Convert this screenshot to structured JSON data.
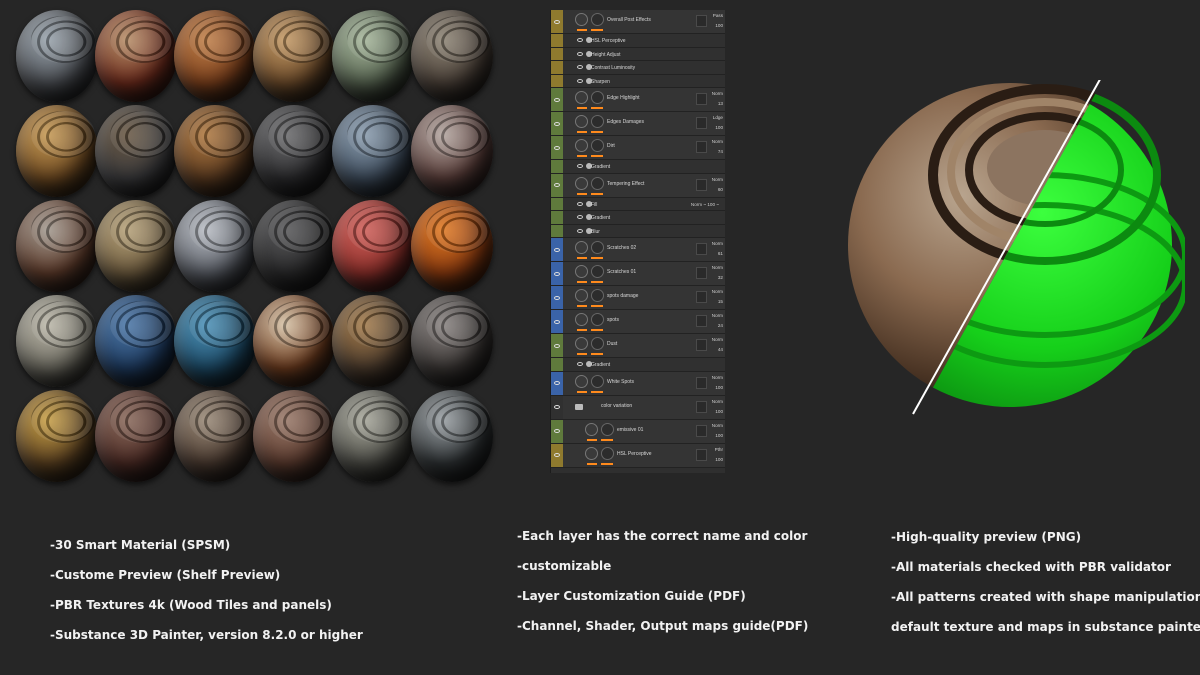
{
  "materials": [
    {
      "base": "#4a4d52",
      "tint": "#9aa4ad"
    },
    {
      "base": "#6a2a1c",
      "tint": "#b8906a"
    },
    {
      "base": "#7a3f1c",
      "tint": "#c0804a"
    },
    {
      "base": "#6b4a2a",
      "tint": "#c49a66"
    },
    {
      "base": "#55624f",
      "tint": "#a7b79c"
    },
    {
      "base": "#4a4038",
      "tint": "#8e8576"
    },
    {
      "base": "#6e4a22",
      "tint": "#c69a55"
    },
    {
      "base": "#3a3a3c",
      "tint": "#6b5a46"
    },
    {
      "base": "#5a3a20",
      "tint": "#b07a42"
    },
    {
      "base": "#2c2c2e",
      "tint": "#6e6e70"
    },
    {
      "base": "#3e4c5c",
      "tint": "#8c9eb0"
    },
    {
      "base": "#5a3e3a",
      "tint": "#b3a6a0"
    },
    {
      "base": "#5c3a2a",
      "tint": "#a39a90"
    },
    {
      "base": "#6c5a3e",
      "tint": "#b6a27a"
    },
    {
      "base": "#5a5e66",
      "tint": "#b9bdc4"
    },
    {
      "base": "#2a2a2b",
      "tint": "#5a5a5c"
    },
    {
      "base": "#8a2f2a",
      "tint": "#d0605a"
    },
    {
      "base": "#8a3a10",
      "tint": "#e07a24"
    },
    {
      "base": "#6c6a60",
      "tint": "#bcb8aa"
    },
    {
      "base": "#1e3a5e",
      "tint": "#4d78a8"
    },
    {
      "base": "#1d4a66",
      "tint": "#4e92b8"
    },
    {
      "base": "#6a3a1e",
      "tint": "#d6c2a6"
    },
    {
      "base": "#4a3a2c",
      "tint": "#a47c4c"
    },
    {
      "base": "#3a3634",
      "tint": "#8a8482"
    },
    {
      "base": "#5a4020",
      "tint": "#c8a048"
    },
    {
      "base": "#4a2a24",
      "tint": "#8a6a5c"
    },
    {
      "base": "#4a3a30",
      "tint": "#9a8a78"
    },
    {
      "base": "#5a3a2e",
      "tint": "#9a7a6a"
    },
    {
      "base": "#4c4c46",
      "tint": "#a8a89c"
    },
    {
      "base": "#2e3234",
      "tint": "#9aa0a4"
    }
  ],
  "layers": [
    {
      "kind": "big",
      "name": "Overall Post Effects",
      "color": "#8f7a2e",
      "blend": "Pass",
      "opacity": "100"
    },
    {
      "kind": "small",
      "name": "HSL Perceptive",
      "color": "#8f7a2e"
    },
    {
      "kind": "small",
      "name": "Height Adjust",
      "color": "#8f7a2e"
    },
    {
      "kind": "small",
      "name": "Contrast Luminosity",
      "color": "#8f7a2e"
    },
    {
      "kind": "small",
      "name": "Sharpen",
      "color": "#8f7a2e"
    },
    {
      "kind": "big",
      "name": "Edge Highlight",
      "color": "#5f7a3c",
      "blend": "Norm",
      "opacity": "13"
    },
    {
      "kind": "big",
      "name": "Edges Damages",
      "color": "#5f7a3c",
      "blend": "Ldge",
      "opacity": "100"
    },
    {
      "kind": "big",
      "name": "Dirt",
      "color": "#5f7a3c",
      "blend": "Norm",
      "opacity": "74"
    },
    {
      "kind": "small",
      "name": "Gradient",
      "color": "#5f7a3c"
    },
    {
      "kind": "big",
      "name": "Tempering Effect",
      "color": "#5f7a3c",
      "blend": "Norm",
      "opacity": "60"
    },
    {
      "kind": "small",
      "name": "Fill",
      "color": "#5f7a3c",
      "extra": "Norm ~  100 ~"
    },
    {
      "kind": "small",
      "name": "Gradient",
      "color": "#5f7a3c"
    },
    {
      "kind": "small",
      "name": "Blur",
      "color": "#5f7a3c"
    },
    {
      "kind": "big",
      "name": "Scratches 02",
      "color": "#3a63a8",
      "blend": "Norm",
      "opacity": "61"
    },
    {
      "kind": "big",
      "name": "Scratches 01",
      "color": "#3a63a8",
      "blend": "Norm",
      "opacity": "32"
    },
    {
      "kind": "big",
      "name": "spots damage",
      "color": "#3a63a8",
      "blend": "Norm",
      "opacity": "15"
    },
    {
      "kind": "big",
      "name": "spots",
      "color": "#3a63a8",
      "blend": "Norm",
      "opacity": "24"
    },
    {
      "kind": "big",
      "name": "Dust",
      "color": "#5f7a3c",
      "blend": "Norm",
      "opacity": "44"
    },
    {
      "kind": "small",
      "name": "Gradient",
      "color": "#5f7a3c"
    },
    {
      "kind": "big",
      "name": "White Spots",
      "color": "#3a63a8",
      "blend": "Norm",
      "opacity": "100"
    },
    {
      "kind": "folder",
      "name": "color variation",
      "color": "#303030",
      "blend": "Norm",
      "opacity": "100"
    },
    {
      "kind": "big",
      "name": "emissive 01",
      "color": "#5f7a3c",
      "blend": "Norm",
      "opacity": "100",
      "indent": true
    },
    {
      "kind": "big",
      "name": "HSL Perceptive",
      "color": "#8f7a2e",
      "blend": "Pthr",
      "opacity": "100",
      "indent": true
    }
  ],
  "features": {
    "col1": [
      "-30 Smart Material  (SPSM)",
      "-Custome Preview (Shelf Preview)",
      "-PBR Textures 4k (Wood Tiles and panels)",
      "-Substance 3D Painter, version 8.2.0 or higher"
    ],
    "col2": [
      "-Each layer has the correct name and color",
      "-customizable",
      "-Layer Customization Guide (PDF)",
      "-Channel, Shader, Output maps guide(PDF)"
    ],
    "col3": [
      "-High-quality preview (PNG)",
      "-All materials checked with PBR validator",
      "-All patterns created with shape manipulation using",
      "default texture and maps in substance painter"
    ]
  },
  "colors": {
    "background": "#262626",
    "accent_orange": "#ff8a1c",
    "preview_green": "#16e01a"
  }
}
